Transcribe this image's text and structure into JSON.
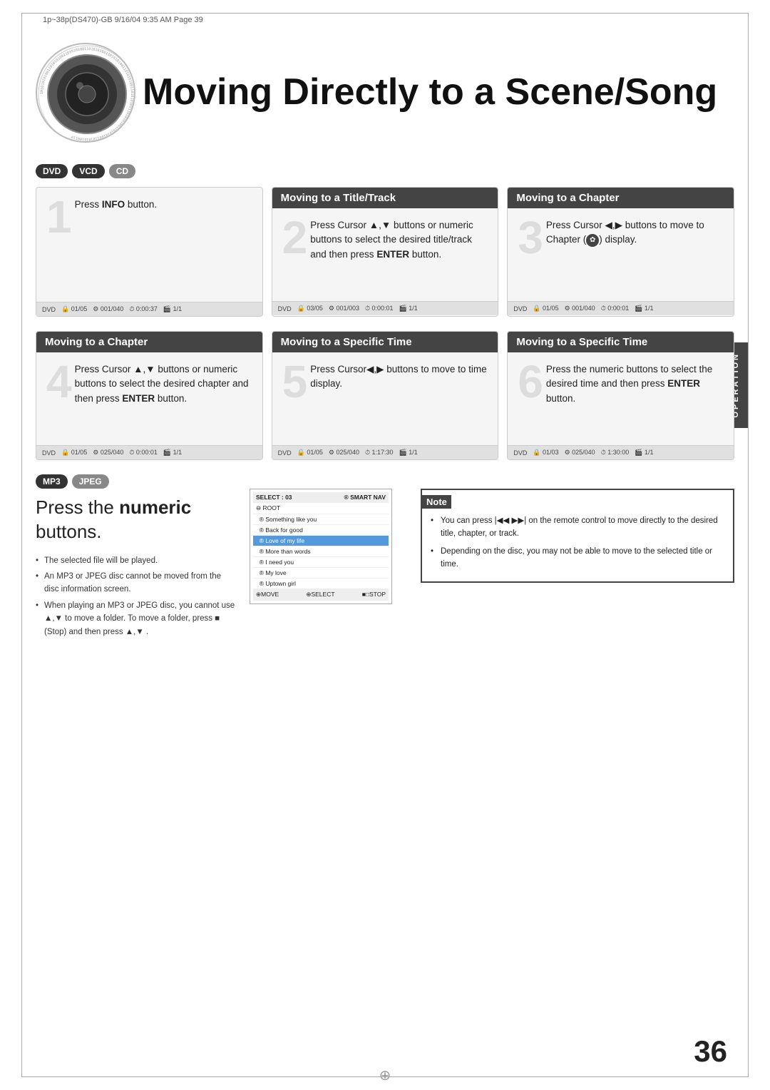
{
  "meta": {
    "header_text": "1p~38p(DS470)-GB   9/16/04  9:35 AM   Page 39",
    "page_number": "36"
  },
  "title": {
    "main": "Moving Directly to a Scene/Song"
  },
  "disc_badges_top": [
    "DVD",
    "VCD",
    "CD"
  ],
  "steps": [
    {
      "number": "1",
      "header": null,
      "text": "Press <b>INFO</b> button.",
      "status": "DVD  🔒 01/05  🎯 001/040  ⏱ 0:00:37  🎬 1/1"
    },
    {
      "number": "2",
      "header": "Moving to a Title/Track",
      "text": "Press Cursor ▲,▼ buttons or numeric buttons to select the desired title/track and then press <b>ENTER</b> button.",
      "status": "DVD  🔒 03/05  🎯 001/003  ⏱ 0:00:01  🎬 1/1"
    },
    {
      "number": "3",
      "header": "Moving to a Chapter",
      "text": "Press Cursor ◀,▶ buttons to move to Chapter (✿) display.",
      "status": "DVD  🔒 01/05  🎯 001/040  ⏱ 0:00:01  🎬 1/1"
    },
    {
      "number": "4",
      "header": "Moving to a Chapter",
      "text": "Press Cursor ▲,▼ buttons or numeric buttons to select the desired chapter and then press <b>ENTER</b> button.",
      "status": "DVD  🔒 01/05  🎯 025/040  ⏱ 0:00:01  🎬 1/1"
    },
    {
      "number": "5",
      "header": "Moving to a Specific Time",
      "text": "Press Cursor◀,▶ buttons to move to time display.",
      "status": "DVD  🔒 01/05  🎯 025/040  ⏱ 1:17:30  🎬 1/1"
    },
    {
      "number": "6",
      "header": "Moving to a Specific Time",
      "text": "Press the numeric buttons to select the desired time and then press <b>ENTER</b> button.",
      "status": "DVD  🔒 01/03  🎯 025/040  ⏱ 1:30:00  🎬 1/1"
    }
  ],
  "bottom": {
    "badges": [
      "MP3",
      "JPEG"
    ],
    "title_before": "Press the ",
    "title_bold": "numeric",
    "title_after": " buttons.",
    "bullets": [
      "The selected file will be played.",
      "An MP3 or JPEG disc cannot be moved from the disc information screen.",
      "When playing an MP3 or JPEG disc, you cannot use ▲,▼  to move a folder. To move a folder, press ■ (Stop) and then press ▲,▼ ."
    ],
    "screen": {
      "header": "SELECT: 03",
      "header2": "® SMART NAV",
      "folder": "⊖ ROOT",
      "items": [
        "® Something like you",
        "® Back for good",
        "® Love of my life",
        "® More than words",
        "® I need you",
        "® My love",
        "® Uptown girl"
      ],
      "selected_index": 2,
      "footer_left": "⊕MOVE",
      "footer_mid": "⊕SELECT",
      "footer_right": "■□STOP"
    },
    "note_title": "Note",
    "note_items": [
      "You can press |◀◀ ▶▶| on the remote control to move directly to the desired title, chapter, or track.",
      "Depending on the disc, you may not be able to move to the selected title or time."
    ]
  },
  "operation_label": "OPERATION"
}
